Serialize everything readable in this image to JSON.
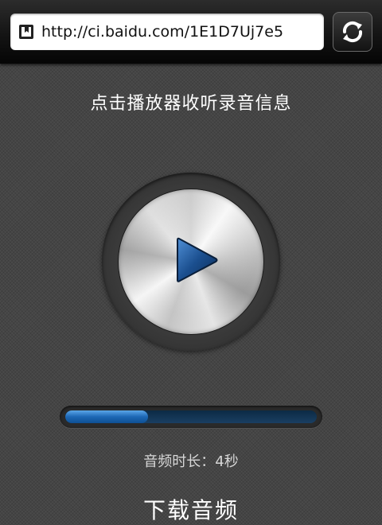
{
  "browser": {
    "url": "http://ci.baidu.com/1E1D7Uj7e5",
    "page_icon": "bookmark-page-icon",
    "refresh_icon": "refresh-icon"
  },
  "player": {
    "prompt": "点击播放器收听录音信息",
    "play_icon": "play-icon",
    "progress_fraction": 0.33,
    "duration_label": "音频时长：4秒",
    "download_label": "下载音频"
  },
  "colors": {
    "background": "#4a4a4a",
    "accent_blue": "#1d67b5",
    "progress_track": "#1a3f62"
  }
}
